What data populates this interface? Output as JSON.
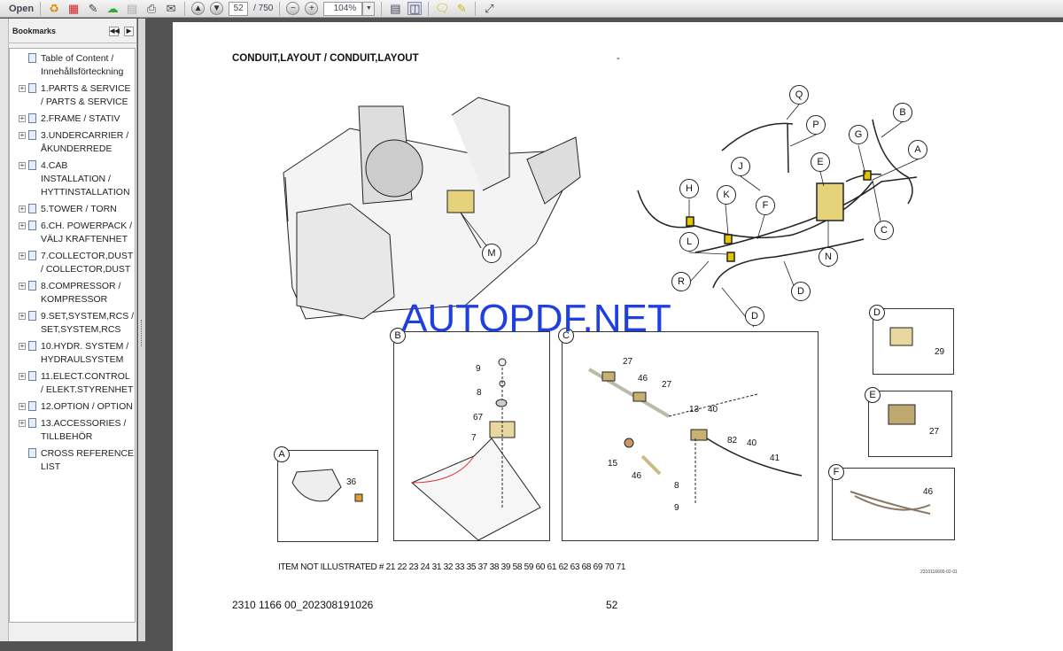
{
  "toolbar": {
    "open_label": "Open",
    "page_current": "52",
    "page_total": "/ 750",
    "zoom": "104%"
  },
  "bookmarks": {
    "title": "Bookmarks",
    "items": [
      {
        "label": "Table of Content / Innehållsförteckning",
        "expandable": false
      },
      {
        "label": "1.PARTS & SERVICE / PARTS & SERVICE",
        "expandable": true
      },
      {
        "label": "2.FRAME / STATIV",
        "expandable": true
      },
      {
        "label": "3.UNDERCARRIER / ÅKUNDERREDE",
        "expandable": true
      },
      {
        "label": "4.CAB INSTALLATION / HYTTINSTALLATION",
        "expandable": true
      },
      {
        "label": "5.TOWER / TORN",
        "expandable": true
      },
      {
        "label": "6.CH. POWERPACK / VÄLJ KRAFTENHET",
        "expandable": true
      },
      {
        "label": "7.COLLECTOR,DUST / COLLECTOR,DUST",
        "expandable": true
      },
      {
        "label": "8.COMPRESSOR / KOMPRESSOR",
        "expandable": true
      },
      {
        "label": "9.SET,SYSTEM,RCS / SET,SYSTEM,RCS",
        "expandable": true
      },
      {
        "label": "10.HYDR. SYSTEM / HYDRAULSYSTEM",
        "expandable": true
      },
      {
        "label": "11.ELECT.CONTROL / ELEKT.STYRENHET",
        "expandable": true
      },
      {
        "label": "12.OPTION / OPTION",
        "expandable": true
      },
      {
        "label": "13.ACCESSORIES / TILLBEHÖR",
        "expandable": true
      },
      {
        "label": "CROSS REFERENCE LIST",
        "expandable": false
      }
    ]
  },
  "document": {
    "title": "CONDUIT,LAYOUT / CONDUIT,LAYOUT",
    "dash": "-",
    "watermark": "AUTOPDF.NET",
    "callouts": [
      "Q",
      "P",
      "B",
      "G",
      "A",
      "J",
      "E",
      "H",
      "K",
      "F",
      "C",
      "L",
      "N",
      "R",
      "D",
      "D",
      "M"
    ],
    "detail_A": {
      "label": "A",
      "parts": [
        "36"
      ]
    },
    "detail_B": {
      "label": "B",
      "parts": [
        "9",
        "8",
        "67",
        "7"
      ]
    },
    "detail_C": {
      "label": "C",
      "parts": [
        "27",
        "46",
        "27",
        "13",
        "40",
        "82",
        "40",
        "41",
        "15",
        "46",
        "8",
        "9"
      ]
    },
    "detail_D": {
      "label": "D",
      "parts": [
        "29"
      ]
    },
    "detail_E": {
      "label": "E",
      "parts": [
        "27"
      ]
    },
    "detail_F": {
      "label": "F",
      "parts": [
        "46"
      ]
    },
    "not_illustrated": "ITEM NOT ILLUSTRATED #  21  22  23  24  31  32  33  35  37  38  39  58  59  60  61  62  63  68  69  70  71",
    "drawing_ref": "2310116600-02-01",
    "footer_doc": "2310 1166 00_202308191026",
    "page_number": "52"
  }
}
